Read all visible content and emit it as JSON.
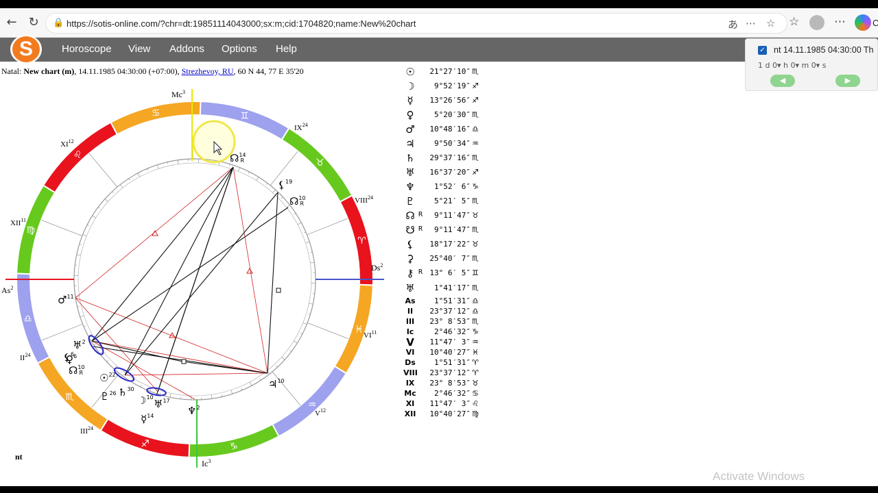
{
  "browser": {
    "url": "https://sotis-online.com/?chr=dt:19851114043000;sx:m;cid:1704820;name:New%20chart",
    "copilot_label": "Co"
  },
  "menu": [
    "Horoscope",
    "View",
    "Addons",
    "Options",
    "Help"
  ],
  "logo_letter": "S",
  "header": {
    "prefix": "Natal:",
    "chart_name": "New chart (m)",
    "datetime": ", 14.11.1985 04:30:00 (+07:00),",
    "place": "Strezhevoy, RU",
    "coords": ", 60 N 44, 77 E 35'20"
  },
  "wheel_labels": {
    "mc": "Mc",
    "mc_deg": "3",
    "ic": "Ic",
    "ic_deg": "3",
    "as": "As",
    "as_deg": "2",
    "ds": "Ds",
    "ds_deg": "2",
    "houses": [
      {
        "n": "IX",
        "d": "24"
      },
      {
        "n": "VIII",
        "d": "24"
      },
      {
        "n": "VI",
        "d": "11"
      },
      {
        "n": "V",
        "d": "12"
      },
      {
        "n": "III",
        "d": "24"
      },
      {
        "n": "II",
        "d": "24"
      },
      {
        "n": "XII",
        "d": "11"
      },
      {
        "n": "XI",
        "d": "12"
      }
    ],
    "planets": [
      {
        "g": "☊",
        "d": "14",
        "r": "R"
      },
      {
        "g": "⚸",
        "d": "19",
        "r": ""
      },
      {
        "g": "☊",
        "d": "10",
        "r": "R"
      },
      {
        "g": "♂",
        "d": "11",
        "r": ""
      },
      {
        "g": "♅",
        "d": "2",
        "r": ""
      },
      {
        "g": "⚸",
        "d": "6",
        "r": ""
      },
      {
        "g": "♀",
        "d": "6",
        "r": ""
      },
      {
        "g": "☊",
        "d": "10",
        "r": "R"
      },
      {
        "g": "☉",
        "d": "22",
        "r": ""
      },
      {
        "g": "♄",
        "d": "30",
        "r": ""
      },
      {
        "g": "♇",
        "d": "26",
        "r": ""
      },
      {
        "g": "☽",
        "d": "10",
        "r": ""
      },
      {
        "g": "♅",
        "d": "17",
        "r": ""
      },
      {
        "g": "☿",
        "d": "14",
        "r": ""
      },
      {
        "g": "♆",
        "d": "2",
        "r": ""
      },
      {
        "g": "♃",
        "d": "10",
        "r": ""
      }
    ],
    "bottom_left": "nt"
  },
  "positions": [
    {
      "g": "☉",
      "r": "",
      "v": "21°27′10″",
      "s": "♏"
    },
    {
      "g": "☽",
      "r": "",
      "v": "9°52′19″",
      "s": "♐"
    },
    {
      "g": "☿",
      "r": "",
      "v": "13°26′56″",
      "s": "♐"
    },
    {
      "g": "♀",
      "r": "",
      "v": "5°20′30″",
      "s": "♏"
    },
    {
      "g": "♂",
      "r": "",
      "v": "10°48′16″",
      "s": "♎"
    },
    {
      "g": "♃",
      "r": "",
      "v": "9°50′34″",
      "s": "♒"
    },
    {
      "g": "♄",
      "r": "",
      "v": "29°37′16″",
      "s": "♏"
    },
    {
      "g": "♅",
      "r": "",
      "v": "16°37′20″",
      "s": "♐"
    },
    {
      "g": "♆",
      "r": "",
      "v": "1°52′ 6″",
      "s": "♑"
    },
    {
      "g": "♇",
      "r": "",
      "v": "5°21′ 5″",
      "s": "♏"
    },
    {
      "g": "☊",
      "r": "R",
      "v": "9°11′47″",
      "s": "♉"
    },
    {
      "g": "☋",
      "r": "R",
      "v": "9°11′47″",
      "s": "♏"
    },
    {
      "g": "⚸",
      "r": "",
      "v": "18°17′22″",
      "s": "♉"
    },
    {
      "g": "⚳",
      "r": "",
      "v": "25°40′ 7″",
      "s": "♏"
    },
    {
      "g": "⚷",
      "r": "R",
      "v": "13° 6′ 5″",
      "s": "♊"
    },
    {
      "g": "♅",
      "r": "",
      "v": "1°41′17″",
      "s": "♏"
    },
    {
      "g": "As",
      "r": "",
      "v": "1°51′31″",
      "s": "♎"
    },
    {
      "g": "II",
      "r": "",
      "v": "23°37′12″",
      "s": "♎"
    },
    {
      "g": "III",
      "r": "",
      "v": "23° 8′53″",
      "s": "♏"
    },
    {
      "g": "Ic",
      "r": "",
      "v": "2°46′32″",
      "s": "♑"
    },
    {
      "g": "V",
      "r": "",
      "v": "11°47′ 3″",
      "s": "♒"
    },
    {
      "g": "VI",
      "r": "",
      "v": "10°40′27″",
      "s": "♓"
    },
    {
      "g": "Ds",
      "r": "",
      "v": "1°51′31″",
      "s": "♈"
    },
    {
      "g": "VIII",
      "r": "",
      "v": "23°37′12″",
      "s": "♈"
    },
    {
      "g": "IX",
      "r": "",
      "v": "23° 8′53″",
      "s": "♉"
    },
    {
      "g": "Mc",
      "r": "",
      "v": "2°46′32″",
      "s": "♋"
    },
    {
      "g": "XI",
      "r": "",
      "v": "11°47′ 3″",
      "s": "♌"
    },
    {
      "g": "XII",
      "r": "",
      "v": "10°40′27″",
      "s": "♍"
    }
  ],
  "ctrl": {
    "label": "nt 14.11.1985 04:30:00 Th",
    "fields": "1   d   0▾ h   0▾ m   0▾ s",
    "prev": "◀",
    "next": "▶"
  },
  "watermark": "Activate Windows",
  "zodiac_colors": {
    "fire": "#e8131d",
    "earth": "#67c91e",
    "air": "#9da1ee",
    "water": "#f5a623"
  }
}
